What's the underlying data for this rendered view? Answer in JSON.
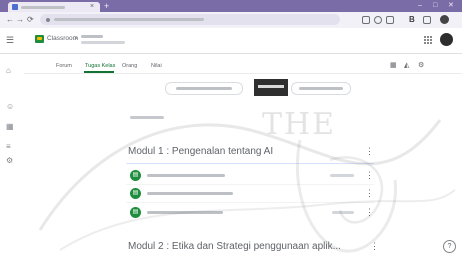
{
  "browser": {
    "tab_close_glyph": "×",
    "new_tab_glyph": "+",
    "window_controls": {
      "minimize": "–",
      "maximize": "□",
      "close": "✕"
    },
    "nav": {
      "back": "←",
      "forward": "→",
      "reload": "⟳"
    },
    "profile_letter": "B"
  },
  "app": {
    "name": "Classroom",
    "breadcrumb_sep": ">"
  },
  "tabs": [
    {
      "label": "Forum"
    },
    {
      "label": "Tugas Kelas",
      "active": true
    },
    {
      "label": "Orang"
    },
    {
      "label": "Nilai"
    }
  ],
  "topics": [
    {
      "title": "Modul 1 : Pengenalan tentang AI",
      "menu_glyph": "⋮",
      "items": [
        {
          "icon": "assignment-icon",
          "glyph": "▤"
        },
        {
          "icon": "material-icon",
          "glyph": "▤"
        },
        {
          "icon": "material-icon",
          "glyph": "▤"
        }
      ]
    },
    {
      "title": "Modul 2 : Etika dan Strategi penggunaan aplik...",
      "menu_glyph": "⋮"
    }
  ],
  "help_glyph": "?",
  "watermark": {
    "text": "THE"
  },
  "colors": {
    "tab_strip": "#7a6ca6",
    "classroom_green": "#1e8e3e",
    "active_tab": "#137333",
    "text": "#3c4043",
    "muted": "#5f6368"
  }
}
